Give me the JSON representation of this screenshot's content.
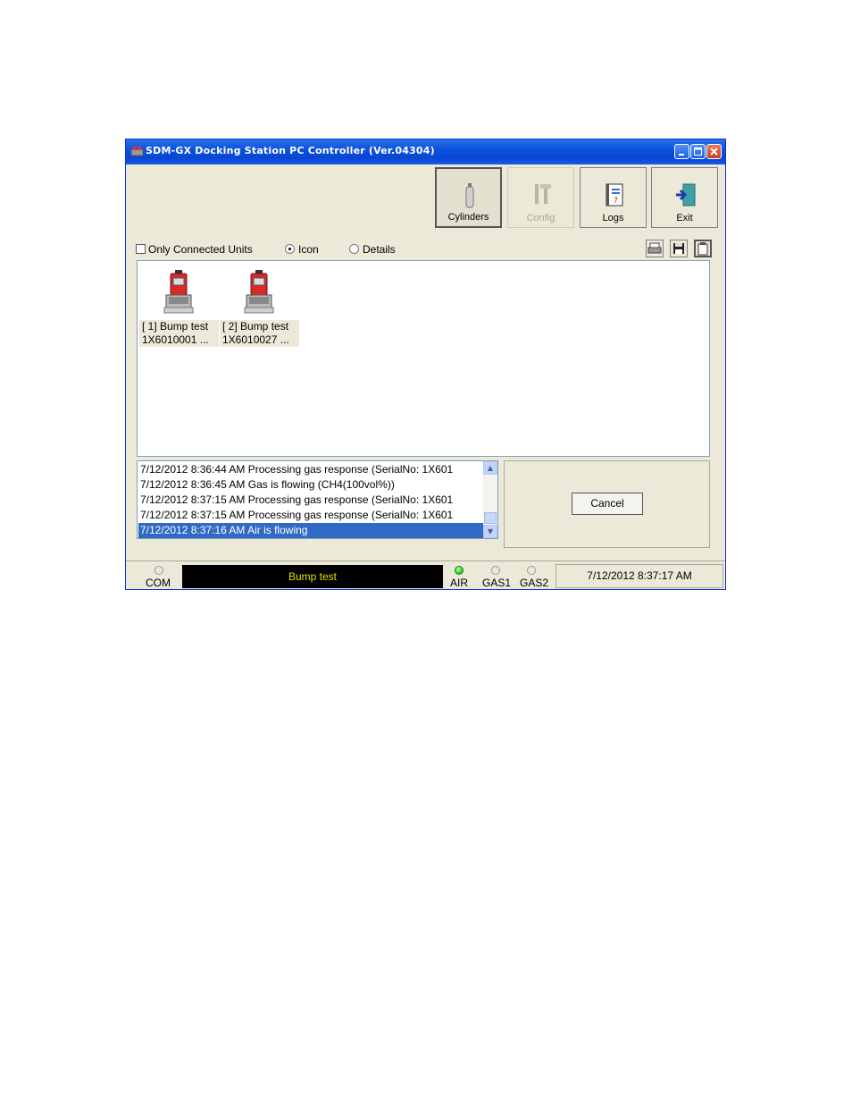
{
  "window": {
    "title": "SDM-GX Docking Station PC Controller (Ver.04304)"
  },
  "toolbar": {
    "cylinders_label": "Cylinders",
    "config_label": "Config",
    "logs_label": "Logs",
    "exit_label": "Exit"
  },
  "options": {
    "only_connected_label": "Only Connected Units",
    "icon_label": "Icon",
    "details_label": "Details",
    "selected_view": "Icon"
  },
  "units": [
    {
      "line1": "[ 1] Bump test",
      "line2": "1X6010001 ..."
    },
    {
      "line1": "[ 2] Bump test",
      "line2": "1X6010027 ..."
    }
  ],
  "log": [
    "7/12/2012 8:36:44 AM Processing gas response (SerialNo: 1X601",
    "7/12/2012 8:36:45 AM Gas is flowing (CH4(100vol%))",
    "7/12/2012 8:37:15 AM Processing gas response (SerialNo: 1X601",
    "7/12/2012 8:37:15 AM Processing gas response (SerialNo: 1X601",
    "7/12/2012 8:37:16 AM Air is flowing"
  ],
  "cancel_label": "Cancel",
  "status": {
    "com_label": "COM",
    "display_text": "Bump test",
    "air_label": "AIR",
    "gas1_label": "GAS1",
    "gas2_label": "GAS2",
    "datetime": "7/12/2012 8:37:17 AM"
  },
  "colors": {
    "titlebar": "#0a52dd",
    "selection": "#316ac5",
    "status_text": "#e0e000",
    "air_led": "#21c016"
  }
}
